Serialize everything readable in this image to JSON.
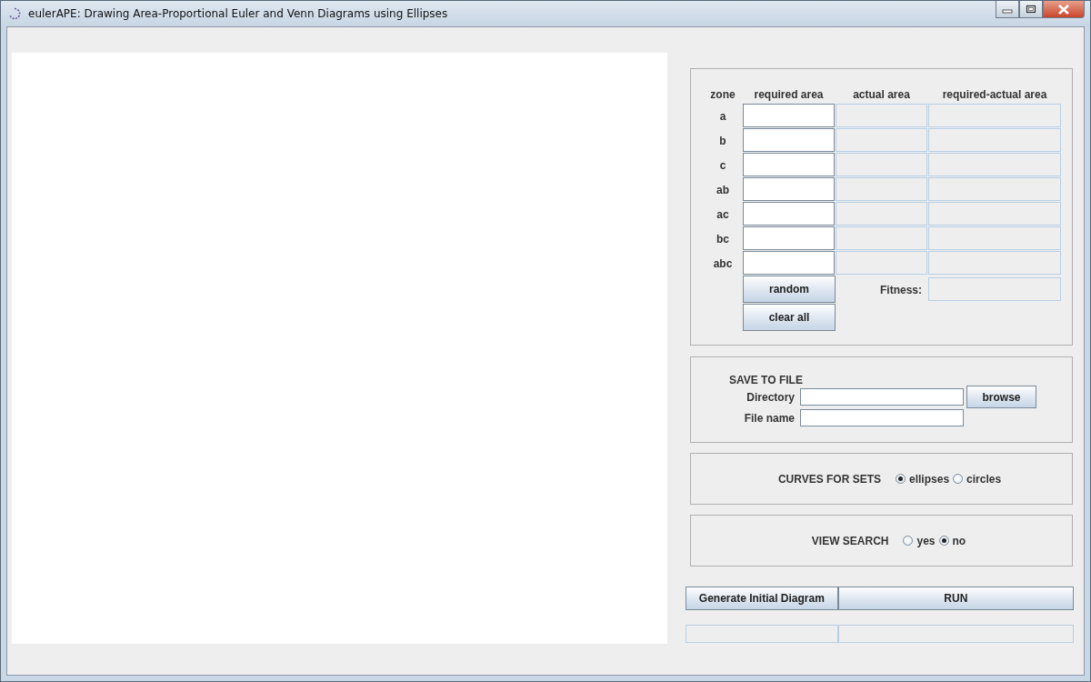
{
  "window": {
    "title": "eulerAPE: Drawing Area-Proportional Euler and Venn Diagrams using Ellipses"
  },
  "zones": {
    "headers": [
      "zone",
      "required area",
      "actual area",
      "required-actual area"
    ],
    "rows": [
      {
        "zone": "a"
      },
      {
        "zone": "b"
      },
      {
        "zone": "c"
      },
      {
        "zone": "ab"
      },
      {
        "zone": "ac"
      },
      {
        "zone": "bc"
      },
      {
        "zone": "abc"
      }
    ],
    "buttons": [
      "random",
      "clear all"
    ],
    "fitness_label": "Fitness:"
  },
  "save": {
    "title": "SAVE TO FILE",
    "directory_label": "Directory",
    "file_name_label": "File name",
    "browse": "browse"
  },
  "curves": {
    "label": "CURVES FOR SETS",
    "options": [
      {
        "label": "ellipses",
        "selected": true
      },
      {
        "label": "circles",
        "selected": false
      }
    ]
  },
  "view_search": {
    "label": "VIEW SEARCH",
    "options": [
      {
        "label": "yes",
        "selected": false
      },
      {
        "label": "no",
        "selected": true
      }
    ]
  },
  "actions": [
    "Generate Initial Diagram",
    "RUN"
  ]
}
